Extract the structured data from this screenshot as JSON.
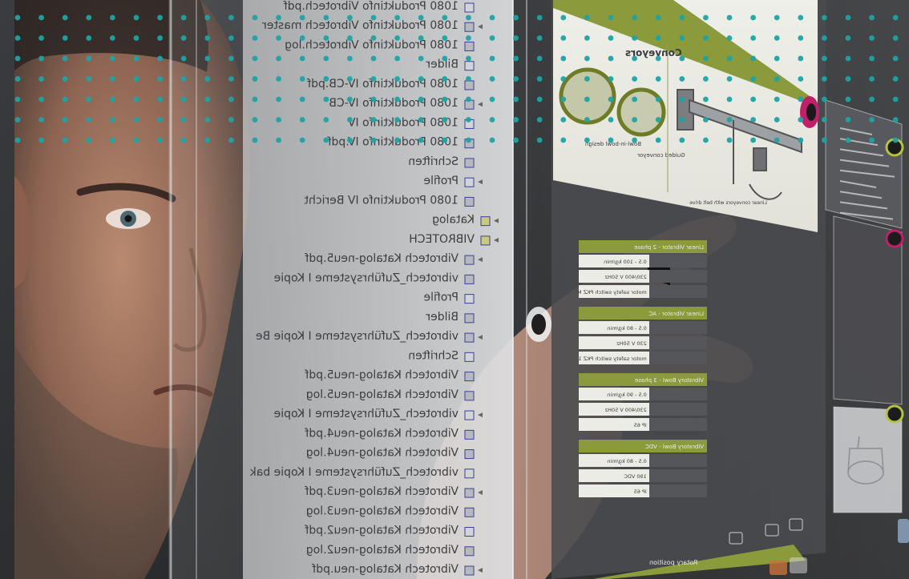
{
  "image": {
    "subject": "person looking at transparent touchscreen, seen from behind the glass (text mirrored)"
  },
  "file_tree": {
    "top_items": [
      "1080 Produktinfo Vibrotech.pdf",
      "1080 Produktinfo Vibrotech master",
      "1080 Produktinfo Vibrotech.log",
      "Bilder",
      "1080 Produktinfo IV-CB.pdf",
      "1080 Produktinfo IV-CB",
      "1080 Produktinfo IV",
      "1080 Produktinfo IV.pdf",
      "Schriften",
      "Profile",
      "1080 Produktinfo IV Bericht"
    ],
    "katalog_label": "Katalog",
    "vibrotech_folder": "VIBROTECH",
    "vibrotech_items": [
      "Vibrotech Katalog-neu5.pdf",
      "vibrotech_Zuführsysteme I Kopie",
      "Profile",
      "Bilder",
      "vibrotech_Zuführsysteme I Kopie Be",
      "Schriften",
      "Vibrotech Katalog-neu5.pdf",
      "Vibrotech Katalog-neu5.log",
      "vibrotech_Zuführsysteme I Kopie",
      "Vibrotech Katalog-neu4.pdf",
      "Vibrotech Katalog-neu4.log",
      "vibrotech_Zuführsysteme I Kopie bak",
      "Vibrotech Katalog-neu3.pdf",
      "Vibrotech Katalog-neu3.log",
      "Vibrotech Katalog-neu2.pdf",
      "Vibrotech Katalog-neu2.log",
      "Vibrotech Katalog-neu.pdf"
    ]
  },
  "brochure": {
    "heading": "Conveyors",
    "caption_left": "Bowl-in-bowl design",
    "caption_mid": "Guided conveyor",
    "footer": "Linear conveyors with belt drive",
    "spec_sections": [
      {
        "title": "Linear Vibrator - 2 phase",
        "rows": [
          "0.5 - 100 kg/min",
          "230/400 V 50Hz",
          "motor safety switch PKZ M"
        ]
      },
      {
        "title": "Linear Vibrator - AC",
        "rows": [
          "0.5 - 80 kg/min",
          "230 V 50Hz",
          "motor safety switch PKZ 1"
        ]
      },
      {
        "title": "Vibratory Bowl - 3 phase",
        "rows": [
          "0.5 - 90 kg/min",
          "230/400 V 50Hz",
          "IP 65"
        ]
      },
      {
        "title": "Vibratory Bowl - VDC",
        "rows": [
          "0.5 - 80 kg/min",
          "190 VDC",
          "IP 65"
        ]
      }
    ],
    "bottom_label": "Rotary position"
  },
  "colors": {
    "accent_green": "#8b9a3a",
    "dot_teal": "#1ba4a4",
    "highlight_magenta": "#c02069",
    "panel_gray": "#4a4b4e"
  },
  "decor": {
    "dot_grid": {
      "rows": 7,
      "cols": 38
    }
  }
}
